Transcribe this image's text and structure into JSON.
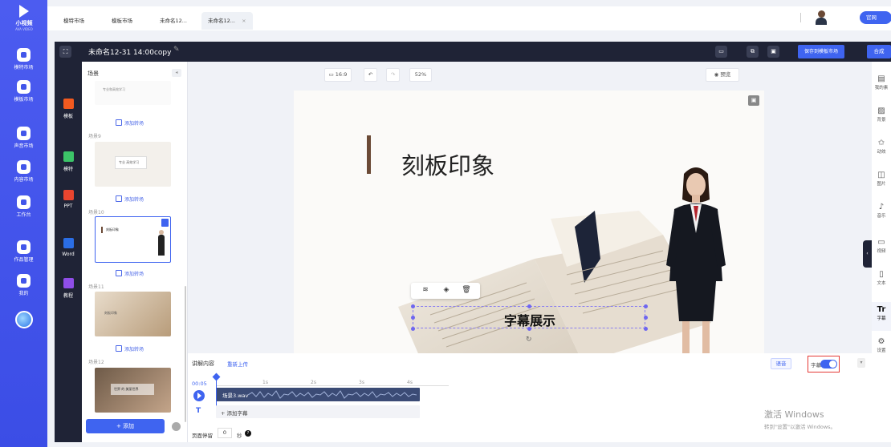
{
  "app": {
    "logo_text": "小视频",
    "logo_sub": "AVA VIDEO"
  },
  "rail": [
    {
      "label": "模特市场"
    },
    {
      "label": "模板市场"
    },
    {
      "label": "声音市场"
    },
    {
      "label": "内容市场"
    },
    {
      "label": "工作台"
    },
    {
      "label": "作品管理"
    },
    {
      "label": "我的"
    }
  ],
  "tabs": [
    {
      "label": "模特市场"
    },
    {
      "label": "模板市场"
    },
    {
      "label": "未命名12..."
    },
    {
      "label": "未命名12...",
      "close": "×"
    }
  ],
  "header": {
    "official": "官网"
  },
  "toolbar": {
    "title": "未命名12-31 14:00copy",
    "edit_icon": "✎",
    "save_template": "保存到模板市场",
    "compose": "合成"
  },
  "secondary_nav": [
    {
      "label": "模板",
      "color": "#f25a1f"
    },
    {
      "label": "模特",
      "color": "#3cc468"
    },
    {
      "label": "PPT",
      "color": "#e8452f"
    },
    {
      "label": "Word",
      "color": "#2b6ee6"
    },
    {
      "label": "教程",
      "color": "#8f4ee8"
    }
  ],
  "scenes": {
    "title": "场景",
    "collapse": "◂",
    "add_transition": "添加转场",
    "items": [
      {
        "label": "场景9"
      },
      {
        "label": "场景10"
      },
      {
        "label": "场景11"
      },
      {
        "label": "场景12"
      }
    ],
    "thumb_texts": {
      "s8": "专业和高效学习",
      "s9": "专业 高效学习",
      "s10": "刻板印象",
      "s11": "刻板印象",
      "s12": "世界 的 美丽世界"
    },
    "add_button": "+ 添加"
  },
  "canvas": {
    "ratio": "16:9",
    "undo": "↶",
    "redo": "↷",
    "zoom": "52%",
    "preview": "预览",
    "slide_title": "刻板印象",
    "caption": "字幕展示"
  },
  "rightbar": [
    {
      "label": "我的素",
      "glyph": "▤"
    },
    {
      "label": "背景",
      "glyph": "▨"
    },
    {
      "label": "动效",
      "glyph": "✩"
    },
    {
      "label": "图片",
      "glyph": "◫"
    },
    {
      "label": "音乐",
      "glyph": "♪"
    },
    {
      "label": "视频",
      "glyph": "▭"
    },
    {
      "label": "文本",
      "glyph": "▯"
    },
    {
      "label": "字幕",
      "glyph": "Tr"
    },
    {
      "label": "设置",
      "glyph": "⚙"
    }
  ],
  "narration": {
    "label": "讲解内容",
    "reupload": "重新上传",
    "voice": "语音",
    "subtitle_label": "字幕",
    "subtitle_on": true,
    "current_time": "00:05",
    "ticks": [
      "1s",
      "2s",
      "3s",
      "4s"
    ],
    "audio_file": "场景3.wav",
    "add_subtitle": "+ 添加字幕",
    "page_stay_label": "页面停留",
    "page_stay_value": "0",
    "page_stay_unit": "秒"
  },
  "watermark": {
    "line1": "激活 Windows",
    "line2": "转到\"设置\"以激活 Windows。"
  }
}
